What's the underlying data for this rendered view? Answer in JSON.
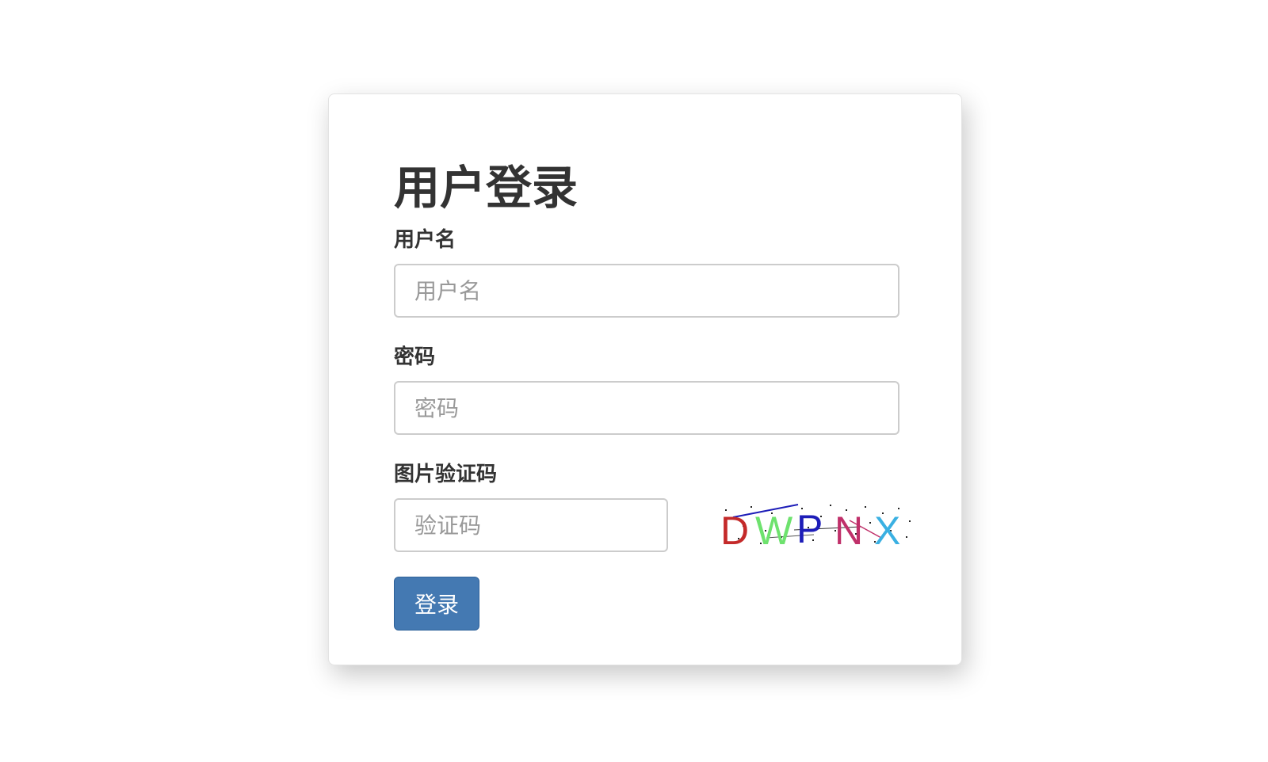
{
  "login": {
    "title": "用户登录",
    "username": {
      "label": "用户名",
      "placeholder": "用户名",
      "value": ""
    },
    "password": {
      "label": "密码",
      "placeholder": "密码",
      "value": ""
    },
    "captcha": {
      "label": "图片验证码",
      "placeholder": "验证码",
      "value": "",
      "image_text": "DWPNX"
    },
    "submit_label": "登录"
  },
  "colors": {
    "primary": "#4479b2",
    "text": "#333333",
    "border": "#cccccc",
    "captcha_chars": [
      "#c42a2a",
      "#6ee26e",
      "#1d1db8",
      "#c0306a",
      "#3ab0e2"
    ]
  }
}
